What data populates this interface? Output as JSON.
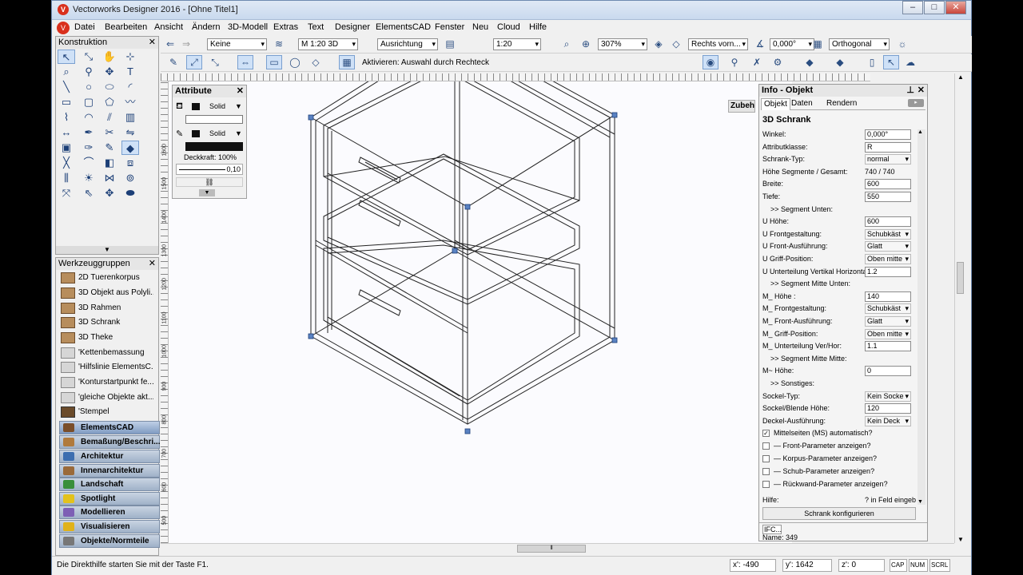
{
  "window": {
    "title": "Vectorworks Designer 2016 - [Ohne Titel1]",
    "app_icon": "V"
  },
  "menu": [
    "Datei",
    "Bearbeiten",
    "Ansicht",
    "Ändern",
    "3D-Modell",
    "Extras",
    "Text",
    "Designer",
    "ElementsCAD",
    "Fenster",
    "Neu",
    "Cloud",
    "Hilfe"
  ],
  "toolbar1": {
    "klasse": "Keine",
    "ebene": "M 1:20 3D",
    "ausrichtung": "Ausrichtung",
    "scale": "1:20",
    "zoom": "307%",
    "view": "Rechts vorn...",
    "angle": "0,000°",
    "projection": "Orthogonal"
  },
  "toolbar2": {
    "mode_text": "Aktivieren: Auswahl durch Rechteck"
  },
  "konstruktion": {
    "title": "Konstruktion"
  },
  "attribute": {
    "title": "Attribute",
    "fill_style": "Solid",
    "pen_style": "Solid",
    "opacity": "Deckkraft: 100%",
    "line_width": "0,10"
  },
  "werkzeuggruppen": {
    "title": "Werkzeuggruppen",
    "items": [
      "2D Tuerenkorpus",
      "3D Objekt aus Polyli...",
      "3D Rahmen",
      "3D Schrank",
      "3D Theke",
      "'Kettenbemassung",
      "'Hilfslinie ElementsC...",
      "'Konturstartpunkt fe...",
      "'gleiche Objekte akt...",
      "'Stempel"
    ],
    "categories": [
      "ElementsCAD",
      "Bemaßung/Beschri...",
      "Architektur",
      "Innenarchitektur",
      "Landschaft",
      "Spotlight",
      "Modellieren",
      "Visualisieren",
      "Objekte/Normteile"
    ]
  },
  "ruler": {
    "v_labels": [
      "1600",
      "1500",
      "1400",
      "1300",
      "1200",
      "1100",
      "1000",
      "900",
      "800",
      "700",
      "600",
      "500"
    ]
  },
  "zubeh_tab": "Zubeh",
  "info": {
    "title": "Info - Objekt",
    "tabs": [
      "Objekt",
      "Daten",
      "Rendern"
    ],
    "object_type": "3D Schrank",
    "rows": [
      {
        "label": "Winkel:",
        "value": "0,000°",
        "kind": "input"
      },
      {
        "label": "Attributklasse:",
        "value": "R",
        "kind": "input"
      },
      {
        "label": "Schrank-Typ:",
        "value": "normal",
        "kind": "select"
      },
      {
        "label": "Höhe Segmente / Gesamt:",
        "value": "740 / 740",
        "kind": "text"
      },
      {
        "label": "Breite:",
        "value": "600",
        "kind": "input"
      },
      {
        "label": "Tiefe:",
        "value": "550",
        "kind": "input"
      },
      {
        "label": ">> Segment Unten:",
        "value": "",
        "kind": "heading"
      },
      {
        "label": "U Höhe:",
        "value": "600",
        "kind": "input"
      },
      {
        "label": "U Frontgestaltung:",
        "value": "Schubkäst",
        "kind": "select"
      },
      {
        "label": "U Front-Ausführung:",
        "value": "Glatt",
        "kind": "select"
      },
      {
        "label": "U Griff-Position:",
        "value": "Oben mitte",
        "kind": "select"
      },
      {
        "label": "U Unterteilung Vertikal Horizontal:",
        "value": "1.2",
        "kind": "input"
      },
      {
        "label": ">> Segment Mitte Unten:",
        "value": "",
        "kind": "heading"
      },
      {
        "label": "M_ Höhe :",
        "value": "140",
        "kind": "input"
      },
      {
        "label": "M_ Frontgestaltung:",
        "value": "Schubkäst",
        "kind": "select"
      },
      {
        "label": "M_ Front-Ausführung:",
        "value": "Glatt",
        "kind": "select"
      },
      {
        "label": "M_ Griff-Position:",
        "value": "Oben mitte",
        "kind": "select"
      },
      {
        "label": "M_ Unterteilung Ver/Hor:",
        "value": "1.1",
        "kind": "input"
      },
      {
        "label": ">> Segment Mitte Mitte:",
        "value": "",
        "kind": "heading"
      },
      {
        "label": "M~ Höhe:",
        "value": "0",
        "kind": "input"
      },
      {
        "label": ">> Sonstiges:",
        "value": "",
        "kind": "heading"
      },
      {
        "label": "Sockel-Typ:",
        "value": "Kein Socke",
        "kind": "select"
      },
      {
        "label": "Sockel/Blende Höhe:",
        "value": "120",
        "kind": "input"
      },
      {
        "label": "Deckel-Ausführung:",
        "value": "Kein Deck",
        "kind": "select"
      }
    ],
    "checks": [
      {
        "label": "Mittelseiten (MS) automatisch?",
        "checked": true
      },
      {
        "label": "— Front-Parameter anzeigen?",
        "checked": false
      },
      {
        "label": "— Korpus-Parameter anzeigen?",
        "checked": false
      },
      {
        "label": "— Schub-Parameter anzeigen?",
        "checked": false
      },
      {
        "label": "— Rückwand-Parameter anzeigen?",
        "checked": false
      }
    ],
    "hilfe_label": "Hilfe:",
    "hilfe_value": "? in Feld eingeb",
    "configure_button": "Schrank konfigurieren",
    "ifc": "IFC...",
    "name": "Name: 349"
  },
  "status": {
    "hint": "Die Direkthilfe starten Sie mit der Taste F1.",
    "x": "x': -490",
    "y": "y': 1642",
    "z": "z': 0",
    "caps": "CAP",
    "num": "NUM",
    "scrl": "SCRL"
  }
}
